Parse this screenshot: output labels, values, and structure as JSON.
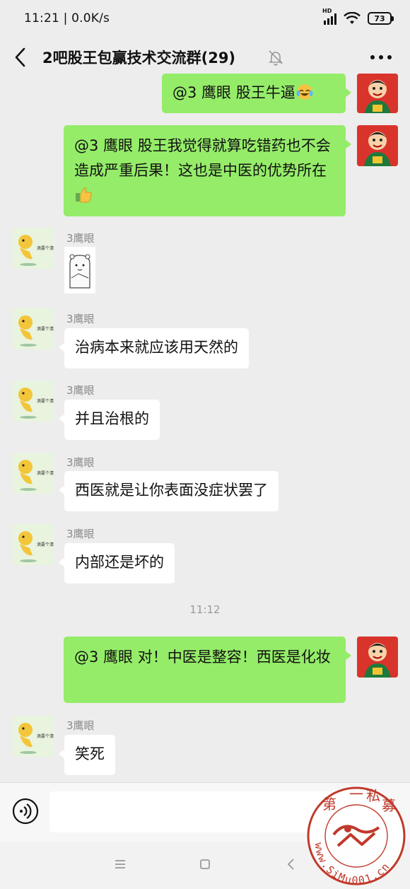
{
  "status_bar": {
    "time": "11:21 | 0.0K/s",
    "network_label": "HD",
    "battery": "73"
  },
  "header": {
    "title": "2吧股王包赢技术交流群(29)"
  },
  "messages": {
    "m1": {
      "text": "@3 鹰眼  股王牛逼"
    },
    "m2": {
      "text": "@3 鹰眼  股王我觉得就算吃错药也不会造成严重后果！这也是中医的优势所在"
    },
    "m3": {
      "sender": "3鹰眼"
    },
    "m4": {
      "sender": "3鹰眼",
      "text": "治病本来就应该用天然的"
    },
    "m5": {
      "sender": "3鹰眼",
      "text": "并且治根的"
    },
    "m6": {
      "sender": "3鹰眼",
      "text": "西医就是让你表面没症状罢了"
    },
    "m7": {
      "sender": "3鹰眼",
      "text": "内部还是坏的"
    },
    "timestamp": "11:12",
    "m8": {
      "text": "@3 鹰眼  对！中医是整容！西医是化妆"
    },
    "m9": {
      "sender": "3鹰眼",
      "text": "笑死"
    }
  },
  "avatar_caption": "滴要个清",
  "input": {
    "value": "",
    "placeholder": ""
  },
  "watermark": {
    "chars": [
      "第",
      "一",
      "私",
      "募"
    ],
    "url": "www.SiMu001.cn"
  },
  "colors": {
    "background": "#ededed",
    "outgoing_bubble": "#95ec69",
    "incoming_bubble": "#ffffff",
    "watermark": "#c0392b"
  }
}
